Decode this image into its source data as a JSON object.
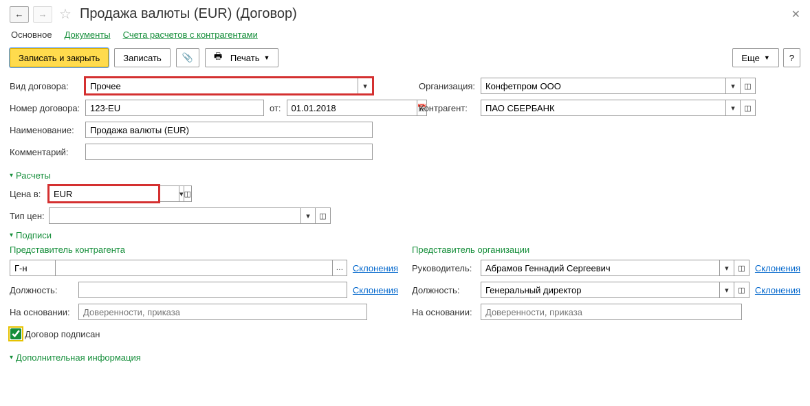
{
  "header": {
    "title": "Продажа валюты (EUR) (Договор)"
  },
  "tabs": {
    "main": "Основное",
    "docs": "Документы",
    "accounts": "Счета расчетов с контрагентами"
  },
  "toolbar": {
    "save_close": "Записать и закрыть",
    "save": "Записать",
    "print": "Печать",
    "more": "Еще",
    "help": "?"
  },
  "fields": {
    "contract_type_lbl": "Вид договора:",
    "contract_type": "Прочее",
    "org_lbl": "Организация:",
    "org": "Конфетпром ООО",
    "num_lbl": "Номер договора:",
    "num": "123-EU",
    "from_lbl": "от:",
    "date": "01.01.2018",
    "counterparty_lbl": "Контрагент:",
    "counterparty": "ПАО СБЕРБАНК",
    "name_lbl": "Наименование:",
    "name": "Продажа валюты (EUR)",
    "comment_lbl": "Комментарий:",
    "comment": ""
  },
  "calc": {
    "title": "Расчеты",
    "price_in_lbl": "Цена в:",
    "price_in": "EUR",
    "price_type_lbl": "Тип цен:",
    "price_type": ""
  },
  "sign": {
    "title": "Подписи",
    "counterparty_rep": "Представитель контрагента",
    "org_rep": "Представитель организации",
    "gn": "Г-н",
    "declension": "Склонения",
    "position_lbl": "Должность:",
    "basis_lbl": "На основании:",
    "basis_ph": "Доверенности, приказа",
    "head_lbl": "Руководитель:",
    "head": "Абрамов Геннадий Сергеевич",
    "position": "Генеральный директор",
    "signed": "Договор подписан"
  },
  "extra": {
    "title": "Дополнительная информация"
  }
}
